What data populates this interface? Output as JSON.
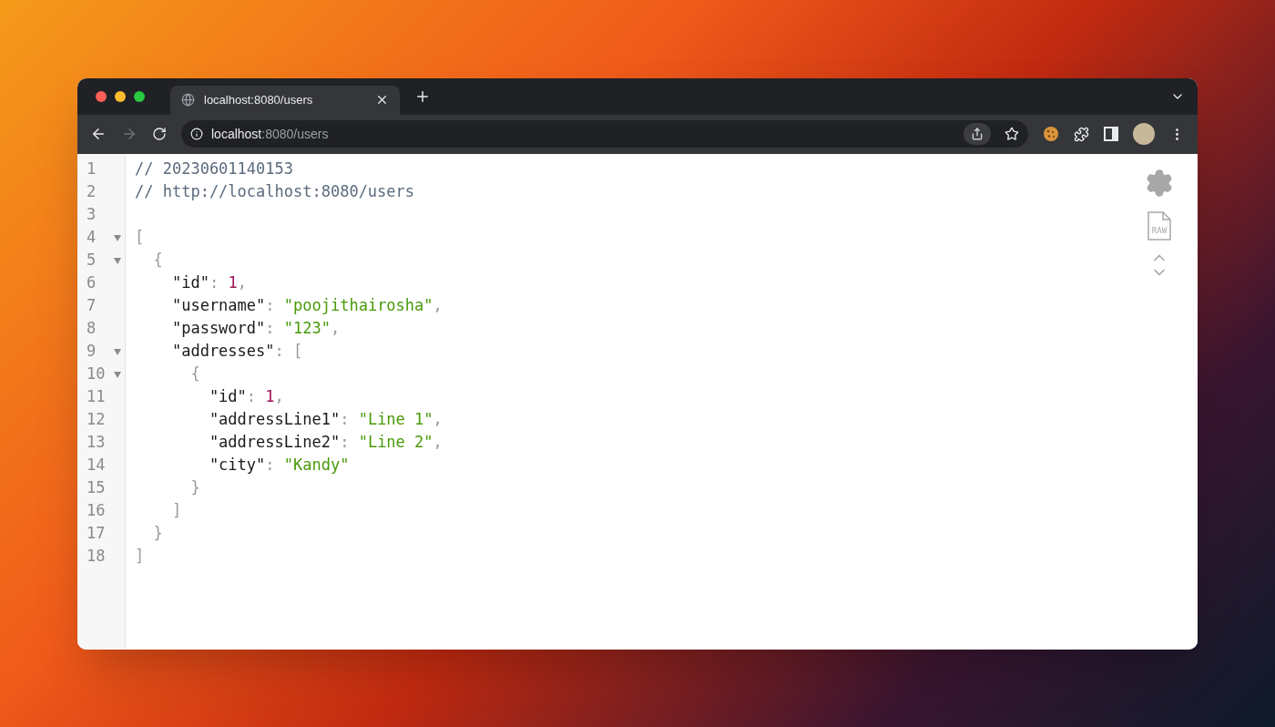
{
  "tab": {
    "title": "localhost:8080/users",
    "selected": true
  },
  "address_bar": {
    "host": "localhost",
    "path": ":8080/users"
  },
  "toolbar": {
    "forward_disabled": true
  },
  "viewer": {
    "raw_label": "RAW"
  },
  "code_lines": [
    {
      "number": "1",
      "foldable": false,
      "tokens": [
        {
          "kind": "comment",
          "text": "// 20230601140153"
        }
      ]
    },
    {
      "number": "2",
      "foldable": false,
      "tokens": [
        {
          "kind": "comment",
          "text": "// http://localhost:8080/users"
        }
      ]
    },
    {
      "number": "3",
      "foldable": false
    },
    {
      "number": "4",
      "foldable": true,
      "tokens": [
        {
          "kind": "punct",
          "text": "["
        }
      ]
    },
    {
      "number": "5",
      "foldable": true,
      "tokens": [
        {
          "kind": "punct",
          "text": "  {"
        }
      ]
    },
    {
      "number": "6",
      "foldable": false,
      "tokens": [
        {
          "kind": "key",
          "text": "    \"id\""
        },
        {
          "kind": "punct",
          "text": ": "
        },
        {
          "kind": "number",
          "text": "1"
        },
        {
          "kind": "punct",
          "text": ","
        }
      ]
    },
    {
      "number": "7",
      "foldable": false,
      "tokens": [
        {
          "kind": "key",
          "text": "    \"username\""
        },
        {
          "kind": "punct",
          "text": ": "
        },
        {
          "kind": "string",
          "text": "\"poojithairosha\""
        },
        {
          "kind": "punct",
          "text": ","
        }
      ]
    },
    {
      "number": "8",
      "foldable": false,
      "tokens": [
        {
          "kind": "key",
          "text": "    \"password\""
        },
        {
          "kind": "punct",
          "text": ": "
        },
        {
          "kind": "string",
          "text": "\"123\""
        },
        {
          "kind": "punct",
          "text": ","
        }
      ]
    },
    {
      "number": "9",
      "foldable": true,
      "tokens": [
        {
          "kind": "key",
          "text": "    \"addresses\""
        },
        {
          "kind": "punct",
          "text": ": ["
        }
      ]
    },
    {
      "number": "10",
      "foldable": true,
      "tokens": [
        {
          "kind": "punct",
          "text": "      {"
        }
      ]
    },
    {
      "number": "11",
      "foldable": false,
      "tokens": [
        {
          "kind": "key",
          "text": "        \"id\""
        },
        {
          "kind": "punct",
          "text": ": "
        },
        {
          "kind": "number",
          "text": "1"
        },
        {
          "kind": "punct",
          "text": ","
        }
      ]
    },
    {
      "number": "12",
      "foldable": false,
      "tokens": [
        {
          "kind": "key",
          "text": "        \"addressLine1\""
        },
        {
          "kind": "punct",
          "text": ": "
        },
        {
          "kind": "string",
          "text": "\"Line 1\""
        },
        {
          "kind": "punct",
          "text": ","
        }
      ]
    },
    {
      "number": "13",
      "foldable": false,
      "tokens": [
        {
          "kind": "key",
          "text": "        \"addressLine2\""
        },
        {
          "kind": "punct",
          "text": ": "
        },
        {
          "kind": "string",
          "text": "\"Line 2\""
        },
        {
          "kind": "punct",
          "text": ","
        }
      ]
    },
    {
      "number": "14",
      "foldable": false,
      "tokens": [
        {
          "kind": "key",
          "text": "        \"city\""
        },
        {
          "kind": "punct",
          "text": ": "
        },
        {
          "kind": "string",
          "text": "\"Kandy\""
        }
      ]
    },
    {
      "number": "15",
      "foldable": false,
      "tokens": [
        {
          "kind": "punct",
          "text": "      }"
        }
      ]
    },
    {
      "number": "16",
      "foldable": false,
      "tokens": [
        {
          "kind": "punct",
          "text": "    ]"
        }
      ]
    },
    {
      "number": "17",
      "foldable": false,
      "tokens": [
        {
          "kind": "punct",
          "text": "  }"
        }
      ]
    },
    {
      "number": "18",
      "foldable": false,
      "tokens": [
        {
          "kind": "punct",
          "text": "]"
        }
      ]
    }
  ]
}
